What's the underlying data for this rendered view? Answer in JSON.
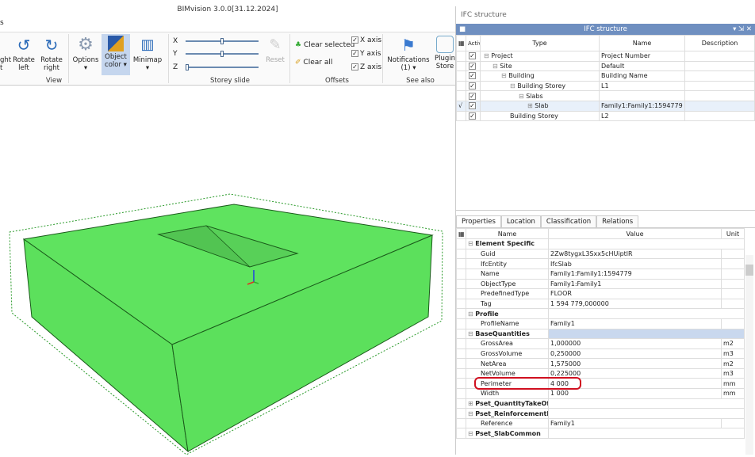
{
  "app": {
    "title": "BIMvision 3.0.0[31.12.2024]",
    "tab_fragment": "s"
  },
  "ribbon": {
    "rotate_right_partial": "ght\nt",
    "rotate_left": "Rotate left",
    "rotate_right": "Rotate right",
    "options": "Options",
    "object_color": "Object color",
    "minimap": "Minimap",
    "view_group": "View",
    "x": "X",
    "y": "Y",
    "z": "Z",
    "reset": "Reset",
    "storey_group": "Storey slide",
    "slider_values": {
      "x": 0.5,
      "y": 0.5,
      "z": 0.0
    },
    "clear_selected": "Clear selected",
    "clear_all": "Clear all",
    "x_axis": "X axis",
    "y_axis": "Y axis",
    "z_axis": "Z axis",
    "offsets_group": "Offsets",
    "notifications": "Notifications (1)",
    "plugin_store": "Plugin Store",
    "see_also_group": "See also"
  },
  "ifc": {
    "panel_title": "IFC structure",
    "bar_title": "IFC structure",
    "columns": [
      "Active",
      "Type",
      "Name",
      "Description"
    ],
    "rows": [
      {
        "type": "Project",
        "name": "Project Number",
        "indent": 0
      },
      {
        "type": "Site",
        "name": "Default",
        "indent": 1
      },
      {
        "type": "Building",
        "name": "Building Name",
        "indent": 2
      },
      {
        "type": "Building Storey",
        "name": "L1",
        "indent": 3
      },
      {
        "type": "Slabs",
        "name": "",
        "indent": 4
      },
      {
        "type": "Slab",
        "name": "Family1:Family1:1594779",
        "indent": 5,
        "selected": true
      },
      {
        "type": "Building Storey",
        "name": "L2",
        "indent": 3
      }
    ]
  },
  "props": {
    "tabs": [
      "Properties",
      "Location",
      "Classification",
      "Relations"
    ],
    "columns": [
      "Name",
      "Value",
      "Unit"
    ],
    "rows": [
      {
        "cat": "Element Specific"
      },
      {
        "name": "Guid",
        "value": "2Zw8tygxL3Sxx5cHUiptlR",
        "unit": ""
      },
      {
        "name": "IfcEntity",
        "value": "IfcSlab",
        "unit": ""
      },
      {
        "name": "Name",
        "value": "Family1:Family1:1594779",
        "unit": ""
      },
      {
        "name": "ObjectType",
        "value": "Family1:Family1",
        "unit": ""
      },
      {
        "name": "PredefinedType",
        "value": "FLOOR",
        "unit": ""
      },
      {
        "name": "Tag",
        "value": "1 594 779,000000",
        "unit": ""
      },
      {
        "cat": "Profile"
      },
      {
        "name": "ProfileName",
        "value": "Family1",
        "unit": ""
      },
      {
        "cat": "BaseQuantities",
        "highlight": true
      },
      {
        "name": "GrossArea",
        "value": "1,000000",
        "unit": "m2"
      },
      {
        "name": "GrossVolume",
        "value": "0,250000",
        "unit": "m3"
      },
      {
        "name": "NetArea",
        "value": "1,575000",
        "unit": "m2"
      },
      {
        "name": "NetVolume",
        "value": "0,225000",
        "unit": "m3"
      },
      {
        "name": "Perimeter",
        "value": "4 000",
        "unit": "mm"
      },
      {
        "name": "Width",
        "value": "1 000",
        "unit": "mm"
      },
      {
        "cat": "Pset_QuantityTakeOff",
        "collapsed": true
      },
      {
        "cat": "Pset_ReinforcementBarPitchOfSlab"
      },
      {
        "name": "Reference",
        "value": "Family1",
        "unit": ""
      },
      {
        "cat": "Pset_SlabCommon"
      }
    ]
  },
  "colors": {
    "slab": "#5fe35f",
    "accent": "#6f8fc0",
    "highlight_border": "#d01020"
  }
}
